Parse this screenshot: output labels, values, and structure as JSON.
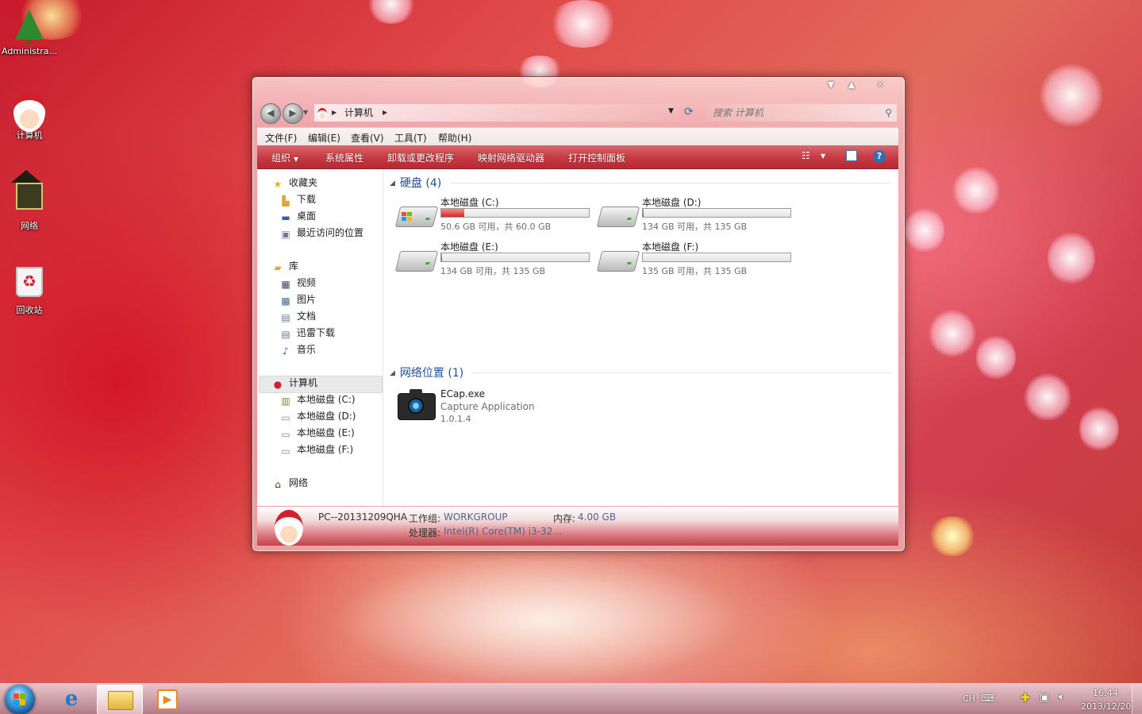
{
  "desktop": {
    "icons": [
      {
        "label": "Administra..."
      },
      {
        "label": "计算机"
      },
      {
        "label": "网络"
      },
      {
        "label": "回收站"
      }
    ]
  },
  "window": {
    "breadcrumb": {
      "location": "计算机"
    },
    "search": {
      "placeholder": "搜索 计算机"
    },
    "menu": [
      "文件(F)",
      "编辑(E)",
      "查看(V)",
      "工具(T)",
      "帮助(H)"
    ],
    "toolbar": {
      "organize": "组织",
      "items": [
        "系统属性",
        "卸载或更改程序",
        "映射网络驱动器",
        "打开控制面板"
      ]
    },
    "nav": {
      "favorites": {
        "label": "收藏夹",
        "items": [
          "下载",
          "桌面",
          "最近访问的位置"
        ]
      },
      "libraries": {
        "label": "库",
        "items": [
          "视频",
          "图片",
          "文档",
          "迅雷下载",
          "音乐"
        ]
      },
      "computer": {
        "label": "计算机",
        "items": [
          "本地磁盘 (C:)",
          "本地磁盘 (D:)",
          "本地磁盘 (E:)",
          "本地磁盘 (F:)"
        ]
      },
      "network": {
        "label": "网络"
      }
    },
    "content": {
      "hard_drives_header": "硬盘 (4)",
      "drives": [
        {
          "name": "本地磁盘 (C:)",
          "info": "50.6 GB 可用，共 60.0 GB",
          "used_fraction": 0.157
        },
        {
          "name": "本地磁盘 (D:)",
          "info": "134 GB 可用，共 135 GB",
          "used_fraction": 0.007
        },
        {
          "name": "本地磁盘 (E:)",
          "info": "134 GB 可用，共 135 GB",
          "used_fraction": 0.007
        },
        {
          "name": "本地磁盘 (F:)",
          "info": "135 GB 可用，共 135 GB",
          "used_fraction": 0.0
        }
      ],
      "network_header": "网络位置 (1)",
      "app": {
        "name": "ECap.exe",
        "desc": "Capture Application",
        "version": "1.0.1.4"
      }
    },
    "details": {
      "pc_name": "PC--20131209QHA",
      "workgroup_label": "工作组:",
      "workgroup_value": "WORKGROUP",
      "memory_label": "内存:",
      "memory_value": "4.00 GB",
      "cpu_label": "处理器:",
      "cpu_value": "Intel(R) Core(TM) i3-32..."
    }
  },
  "taskbar": {
    "lang": "CH",
    "time": "16:44",
    "date": "2013/12/20"
  },
  "colors": {
    "toolbar_red": "#c83c44",
    "link_blue": "#1f4f9a",
    "drive_fill_red": "#cf2b2b"
  }
}
